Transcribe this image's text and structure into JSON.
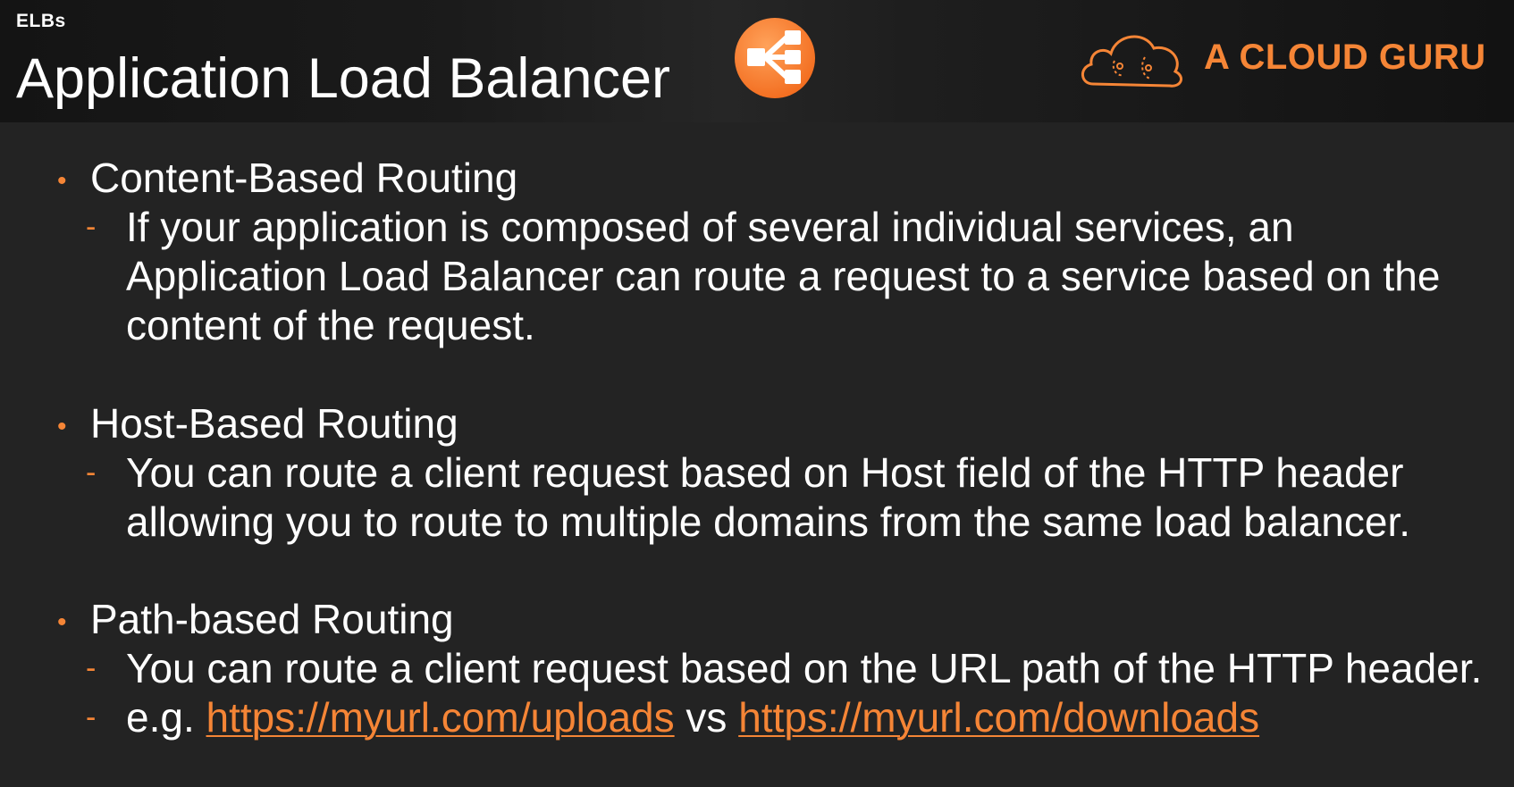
{
  "header": {
    "section_label": "ELBs",
    "title": "Application Load Balancer",
    "icon": "load-balancer-icon",
    "brand_name": "A CLOUD GURU",
    "brand_icon": "cloud-logo-icon"
  },
  "colors": {
    "accent": "#f58536",
    "background": "#232323",
    "text": "#ffffff"
  },
  "items": [
    {
      "title": "Content-Based Routing",
      "subs": [
        {
          "lines": [
            "If your application is composed of several individual services, an",
            "Application Load Balancer can route a request to a service based on the",
            "content of the request."
          ]
        }
      ]
    },
    {
      "title": "Host-Based Routing",
      "subs": [
        {
          "lines": [
            "You can route a client request based on Host field of the HTTP header",
            "allowing you to route to multiple domains from the same load balancer."
          ]
        }
      ]
    },
    {
      "title": "Path-based Routing",
      "subs": [
        {
          "lines": [
            "You can route a client request based on the URL path of the HTTP header."
          ]
        },
        {
          "prefix": "e.g. ",
          "link1": "https://myurl.com/uploads",
          "middle": " vs ",
          "link2": "https://myurl.com/downloads"
        }
      ]
    }
  ]
}
